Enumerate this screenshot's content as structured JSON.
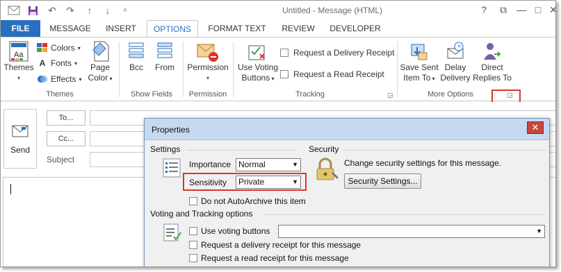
{
  "window": {
    "title": "Untitled - Message (HTML)",
    "qat_icons": [
      "save-icon",
      "undo-icon",
      "redo-icon",
      "up-arrow-icon",
      "down-arrow-icon",
      "customize-icon"
    ],
    "controls": {
      "help": "?",
      "restore": "⧉",
      "minimize": "—",
      "maximize": "□",
      "close": "✕"
    }
  },
  "tabs": [
    {
      "label": "FILE"
    },
    {
      "label": "MESSAGE"
    },
    {
      "label": "INSERT"
    },
    {
      "label": "OPTIONS"
    },
    {
      "label": "FORMAT TEXT"
    },
    {
      "label": "REVIEW"
    },
    {
      "label": "DEVELOPER"
    }
  ],
  "ribbon": {
    "themes": {
      "label": "Themes",
      "themes_button": "Themes",
      "colors": "Colors",
      "fonts": "Fonts",
      "effects": "Effects",
      "page_color_1": "Page",
      "page_color_2": "Color"
    },
    "show_fields": {
      "label": "Show Fields",
      "bcc": "Bcc",
      "from": "From"
    },
    "permission": {
      "label": "Permission",
      "button": "Permission"
    },
    "tracking": {
      "label": "Tracking",
      "voting_1": "Use Voting",
      "voting_2": "Buttons",
      "delivery_receipt": "Request a Delivery Receipt",
      "read_receipt": "Request a Read Receipt"
    },
    "more_options": {
      "label": "More Options",
      "save_sent_1": "Save Sent",
      "save_sent_2": "Item To",
      "delay_1": "Delay",
      "delay_2": "Delivery",
      "direct_1": "Direct",
      "direct_2": "Replies To"
    }
  },
  "compose": {
    "send": "Send",
    "to": "To...",
    "cc": "Cc...",
    "subject": "Subject"
  },
  "dialog": {
    "title": "Properties",
    "settings_header": "Settings",
    "security_header": "Security",
    "importance_label": "Importance",
    "importance_value": "Normal",
    "sensitivity_label": "Sensitivity",
    "sensitivity_value": "Private",
    "security_text": "Change security settings for this message.",
    "security_button": "Security Settings...",
    "autoarchive": "Do not AutoArchive this item",
    "voting_header": "Voting and Tracking options",
    "use_voting": "Use voting buttons",
    "delivery_receipt": "Request a delivery receipt for this message",
    "read_receipt": "Request a read receipt for this message"
  },
  "colors": {
    "accent": "#2a6ebf",
    "highlight": "#d9372a"
  }
}
